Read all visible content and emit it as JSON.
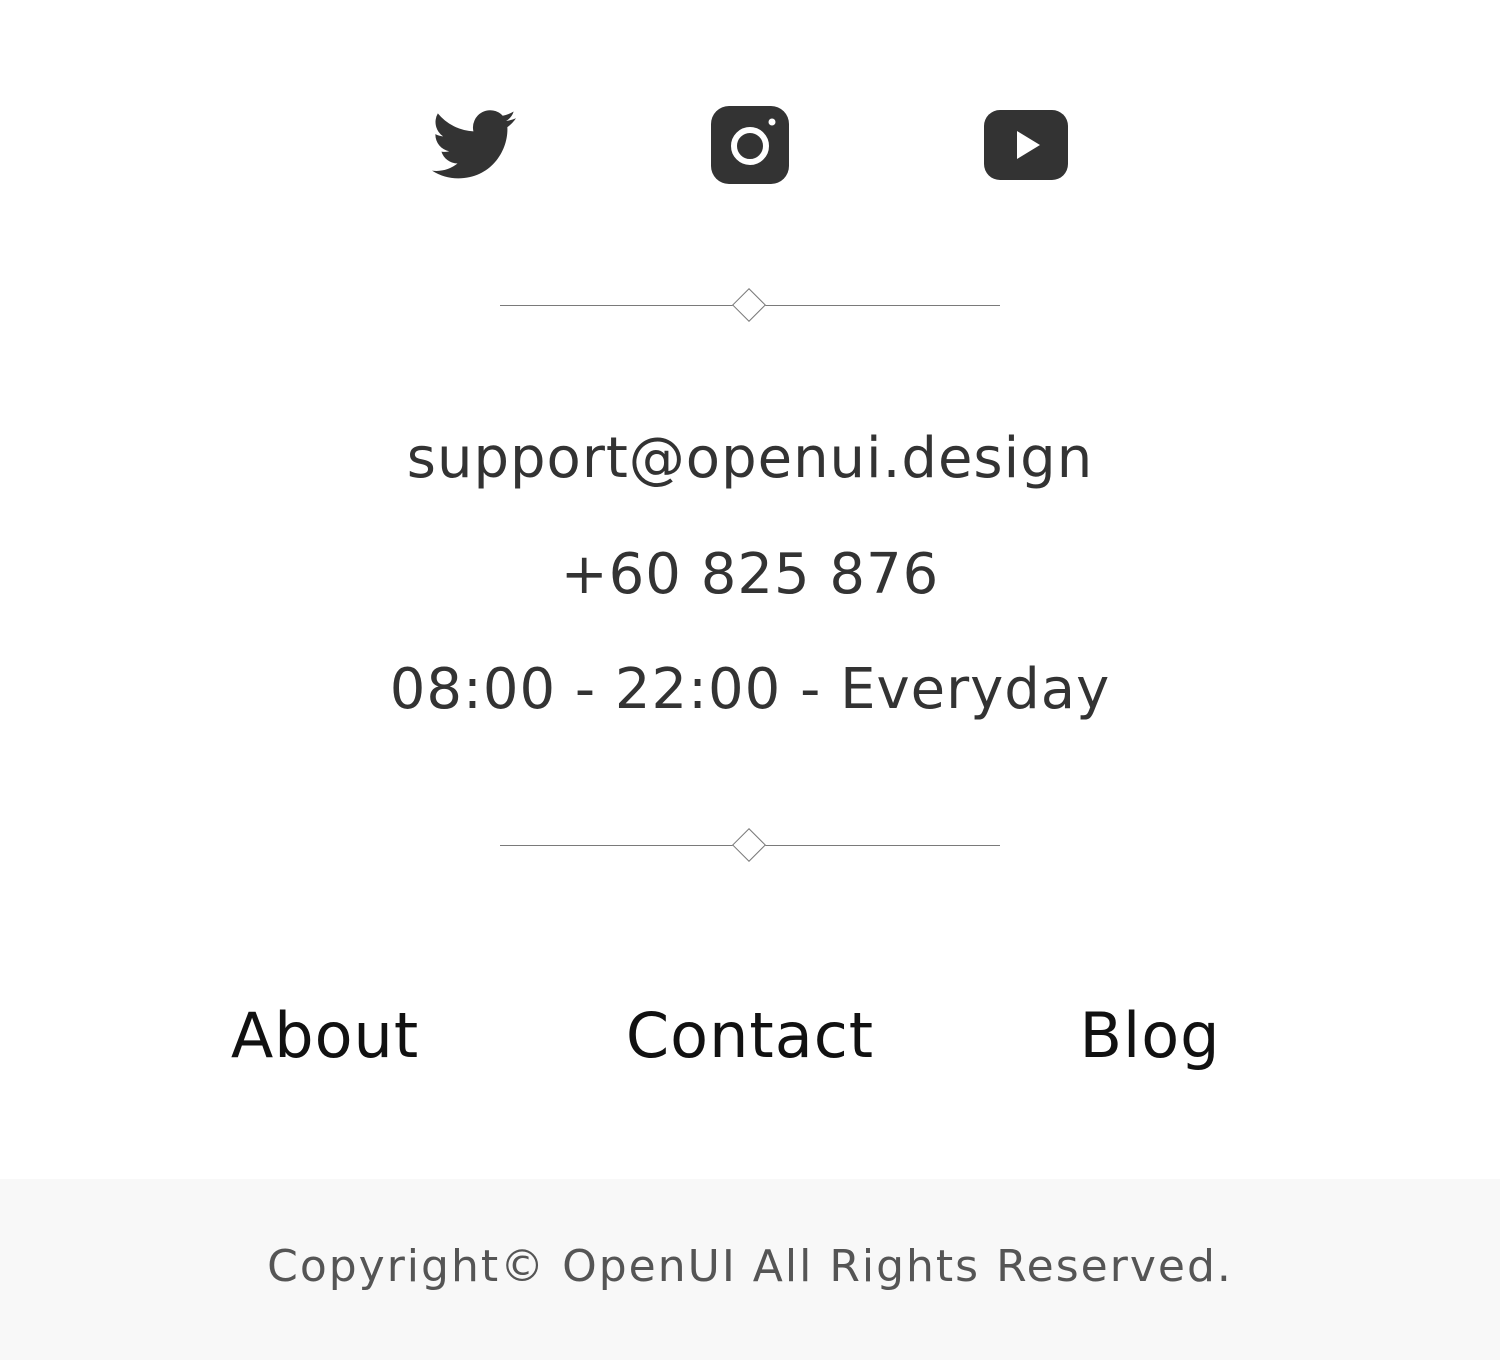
{
  "socials": [
    {
      "name": "twitter",
      "icon": "twitter-icon"
    },
    {
      "name": "instagram",
      "icon": "instagram-icon"
    },
    {
      "name": "youtube",
      "icon": "youtube-icon"
    }
  ],
  "contact": {
    "email": "support@openui.design",
    "phone": "+60 825 876",
    "hours": "08:00 - 22:00 - Everyday"
  },
  "nav": {
    "about": "About",
    "contact": "Contact",
    "blog": "Blog"
  },
  "footer": {
    "copyright": "Copyright© OpenUI All Rights Reserved."
  },
  "colors": {
    "icon": "#333333",
    "text": "#333333",
    "nav": "#111111",
    "footer_bg": "#f8f8f8",
    "divider": "#7a7a7a"
  }
}
